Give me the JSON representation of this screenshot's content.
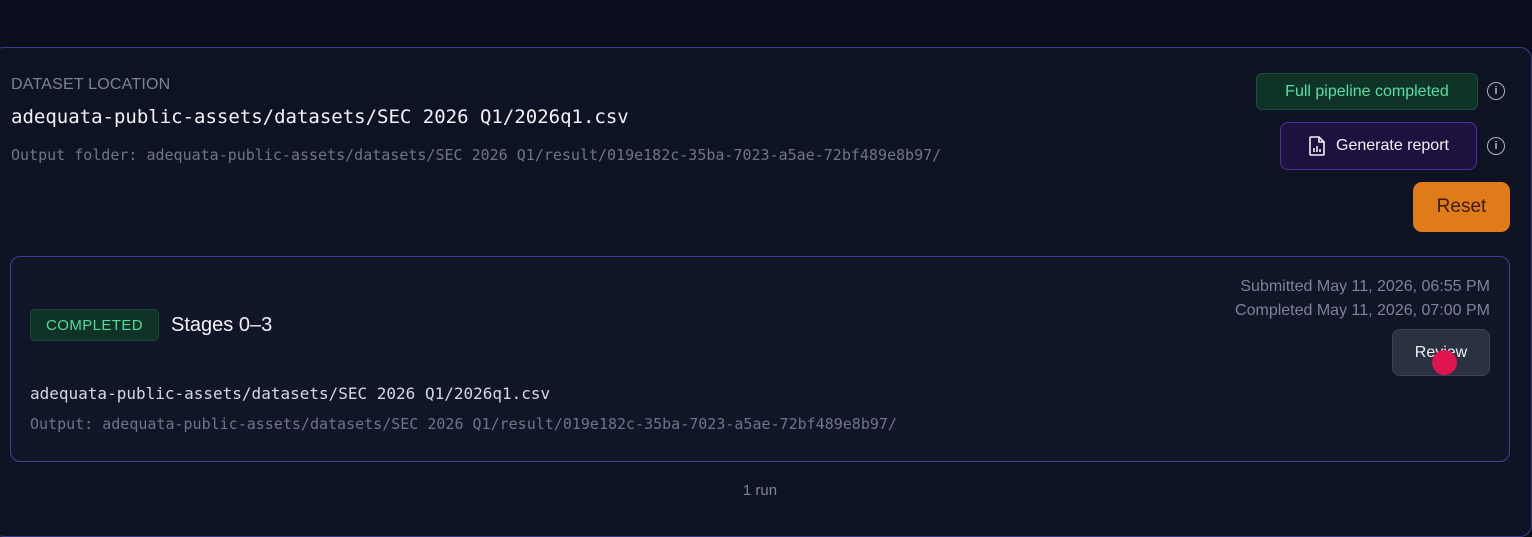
{
  "dataset": {
    "label": "DATASET LOCATION",
    "path": "adequata-public-assets/datasets/SEC 2026 Q1/2026q1.csv",
    "output": "Output folder: adequata-public-assets/datasets/SEC 2026 Q1/result/019e182c-35ba-7023-a5ae-72bf489e8b97/"
  },
  "actions": {
    "pipeline_status": "Full pipeline completed",
    "generate_report": "Generate report",
    "reset": "Reset"
  },
  "run": {
    "status": "COMPLETED",
    "stages": "Stages 0–3",
    "submitted": "Submitted May 11, 2026, 06:55 PM",
    "completed": "Completed May 11, 2026, 07:00 PM",
    "review": "Review",
    "path": "adequata-public-assets/datasets/SEC 2026 Q1/2026q1.csv",
    "output": "Output: adequata-public-assets/datasets/SEC 2026 Q1/result/019e182c-35ba-7023-a5ae-72bf489e8b97/"
  },
  "footer": {
    "run_count": "1 run"
  },
  "colors": {
    "background": "#0b0f1d",
    "accent_border": "#3a3a86",
    "success": "#4fdc9a",
    "reset": "#e07b1a",
    "report_bg": "#1d1140"
  },
  "icons": {
    "info": "info-icon",
    "report": "document-chart-icon"
  }
}
